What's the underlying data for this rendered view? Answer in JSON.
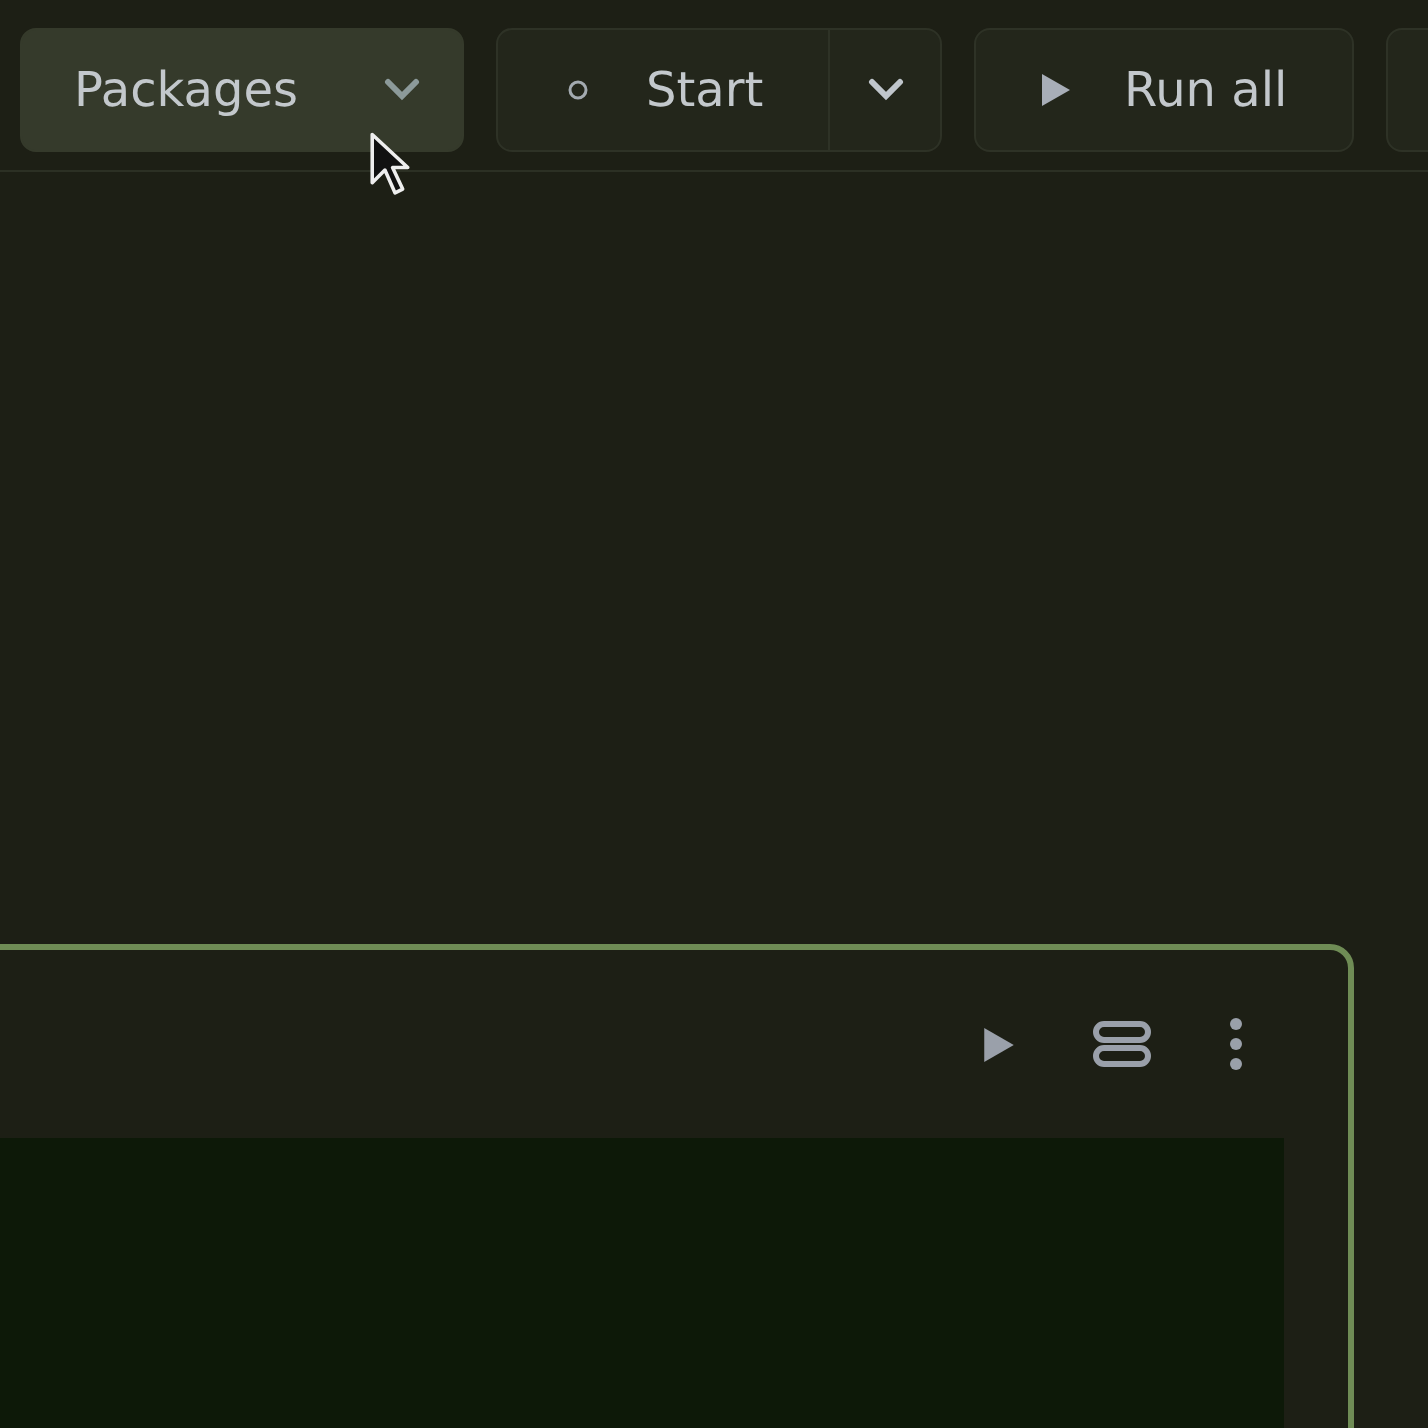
{
  "toolbar": {
    "buttons": [
      {
        "kind": "dropdown",
        "label": "Packages",
        "hovered": true
      },
      {
        "kind": "split",
        "label": "Start",
        "hovered": false
      },
      {
        "kind": "run",
        "label": "Run all",
        "hovered": false
      }
    ]
  },
  "cell": {
    "focused": true
  }
}
